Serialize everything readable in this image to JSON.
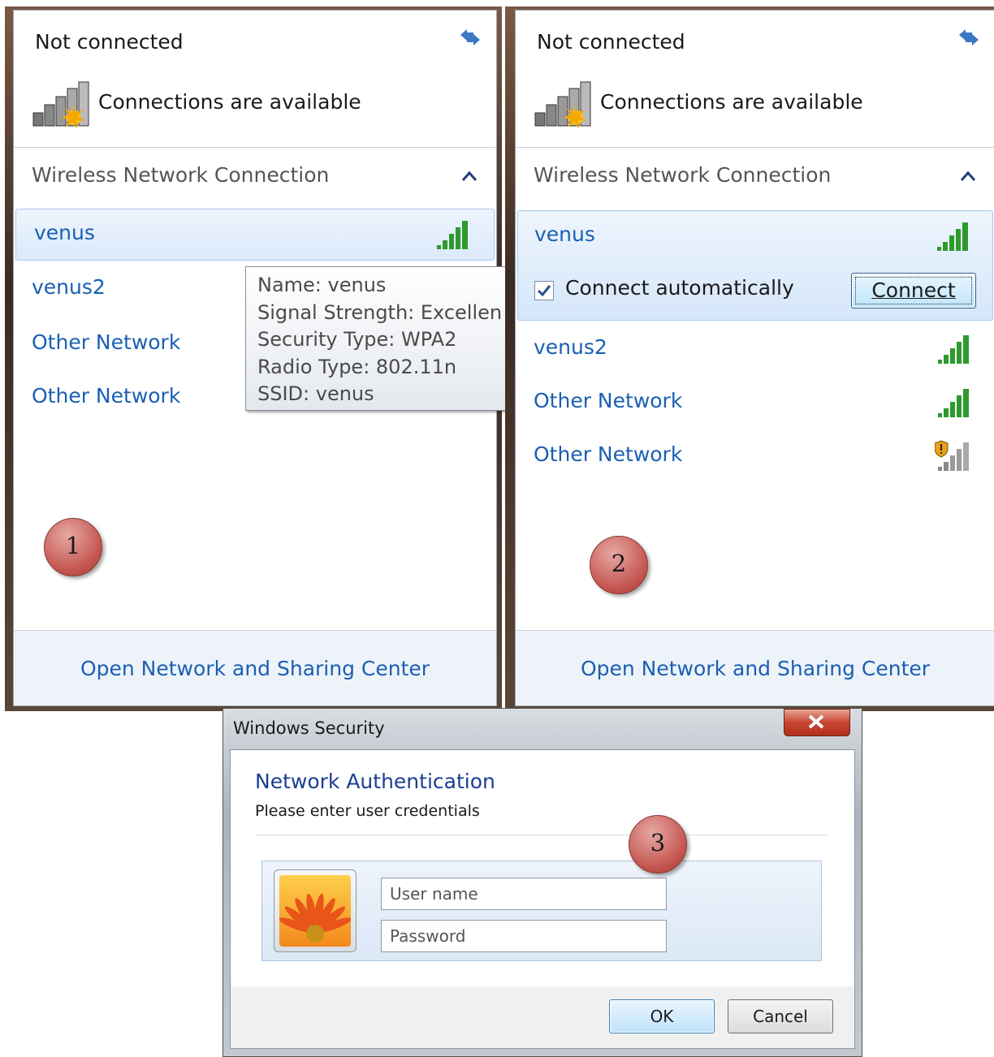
{
  "panels": [
    {
      "title": "Not connected",
      "status": "Connections are available",
      "section": "Wireless Network Connection",
      "networks": [
        "venus",
        "venus2",
        "Other Network",
        "Other Network"
      ],
      "footer_link": "Open Network and Sharing Center",
      "tooltip": {
        "name": "Name: venus",
        "signal": "Signal Strength: Excellen",
        "security": "Security Type: WPA2",
        "radio": "Radio Type: 802.11n",
        "ssid": "SSID: venus"
      },
      "step": "1"
    },
    {
      "title": "Not connected",
      "status": "Connections are available",
      "section": "Wireless Network Connection",
      "networks": [
        "venus",
        "venus2",
        "Other Network",
        "Other Network"
      ],
      "connect_automatically": "Connect automatically",
      "connect_automatically_checked": true,
      "connect_button": "Connect",
      "footer_link": "Open Network and Sharing Center",
      "step": "2"
    }
  ],
  "dialog": {
    "window_title": "Windows Security",
    "heading": "Network Authentication",
    "instruction": "Please enter user credentials",
    "username_placeholder": "User name",
    "password_placeholder": "Password",
    "ok_label": "OK",
    "cancel_label": "Cancel",
    "step": "3"
  },
  "colors": {
    "link_blue": "#1a5fb4",
    "signal_green": "#2e9a2e",
    "badge_red": "#c2514b"
  }
}
